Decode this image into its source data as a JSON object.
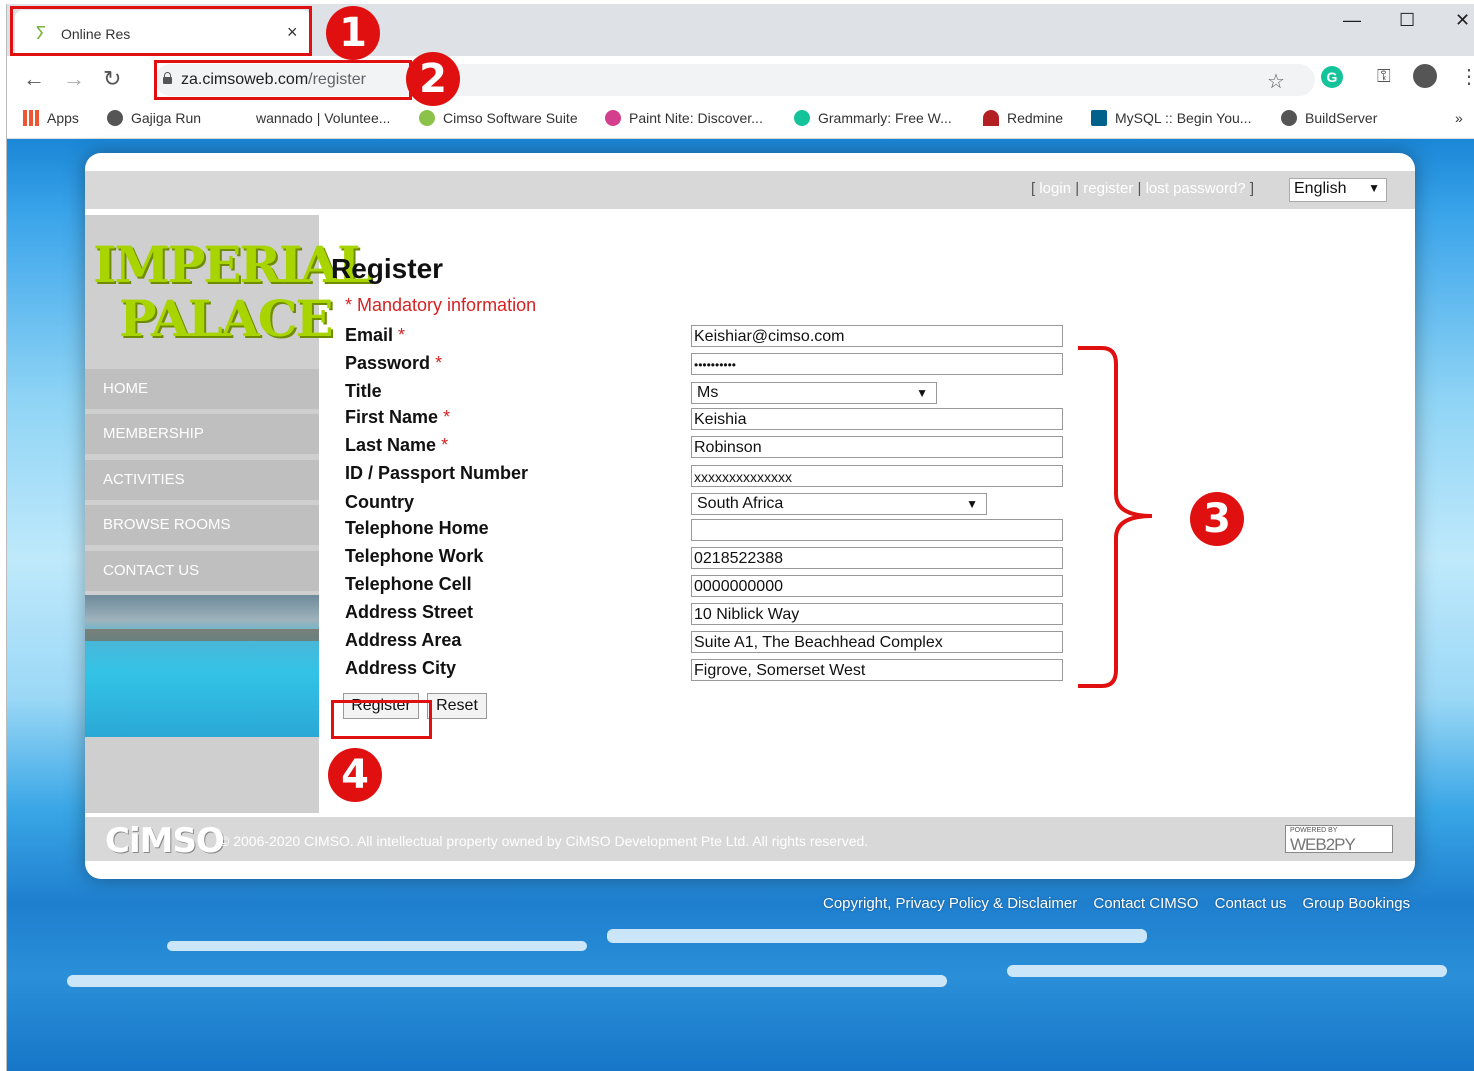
{
  "browser": {
    "tab_title": "Online Res",
    "tab_close": "×",
    "url_host": "za.cimsoweb.com",
    "url_path": "/register",
    "window_controls": [
      "—",
      "☐",
      "✕"
    ],
    "bookmarks": [
      "Apps",
      "Gajiga Run",
      "wannado | Voluntee...",
      "Cimso Software Suite",
      "Paint Nite: Discover...",
      "Grammarly: Free W...",
      "Redmine",
      "MySQL :: Begin You...",
      "BuildServer"
    ],
    "bookmarks_overflow": "»",
    "extension_letter": "G"
  },
  "header": {
    "bracket_open": "[",
    "bracket_close": "]",
    "separator": "|",
    "login": "login",
    "register": "register",
    "lost_password": "lost password?",
    "language": "English"
  },
  "sidebar": {
    "logo_line1": "IMPERIAL",
    "logo_line2": "PALACE",
    "items": [
      "HOME",
      "MEMBERSHIP",
      "ACTIVITIES",
      "BROWSE ROOMS",
      "CONTACT US"
    ]
  },
  "form": {
    "title": "Register",
    "mandatory_note": "* Mandatory information",
    "required_mark": "*",
    "fields": {
      "email": {
        "label": "Email",
        "value": "Keishiar@cimso.com"
      },
      "password": {
        "label": "Password",
        "value": "••••••••••"
      },
      "title": {
        "label": "Title",
        "value": "Ms"
      },
      "first_name": {
        "label": "First Name",
        "value": "Keishia"
      },
      "last_name": {
        "label": "Last Name",
        "value": "Robinson"
      },
      "id_number": {
        "label": "ID / Passport Number",
        "value": "xxxxxxxxxxxxxx"
      },
      "country": {
        "label": "Country",
        "value": "South Africa"
      },
      "tel_home": {
        "label": "Telephone Home",
        "value": ""
      },
      "tel_work": {
        "label": "Telephone Work",
        "value": "0218522388"
      },
      "tel_cell": {
        "label": "Telephone Cell",
        "value": "0000000000"
      },
      "street": {
        "label": "Address Street",
        "value": "10 Niblick Way"
      },
      "area": {
        "label": "Address Area",
        "value": "Suite A1, The Beachhead Complex"
      },
      "city": {
        "label": "Address City",
        "value": "Figrove, Somerset West"
      }
    },
    "register_button": "Register",
    "reset_button": "Reset"
  },
  "footer": {
    "logo": "CiMSO",
    "copyright": "© 2006-2020 CIMSO. All intellectual property owned by CiMSO Development Pte Ltd. All rights reserved.",
    "powered_by": "POWERED BY",
    "web2py": "WEB2PY",
    "links": [
      "Copyright, Privacy Policy & Disclaimer",
      "Contact CIMSO",
      "Contact us",
      "Group Bookings"
    ]
  },
  "annotations": [
    "1",
    "2",
    "3",
    "4"
  ],
  "colors": {
    "annotation": "#e01010",
    "required": "#d62222",
    "accent_green": "#a8d400"
  }
}
